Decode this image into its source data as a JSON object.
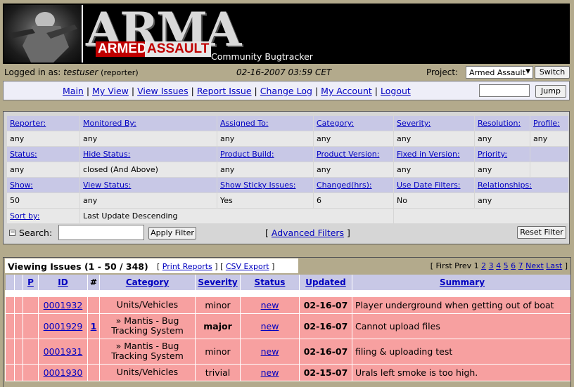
{
  "banner": {
    "logo_big": "ARMA",
    "logo_armed": "ARMED",
    "logo_assault": "ASSAULT",
    "subtitle": "Community Bugtracker"
  },
  "session": {
    "logged_in_label": "Logged in as:",
    "username": "testuser",
    "role": "(reporter)",
    "datetime": "02-16-2007 03:59 CET",
    "project_label": "Project:",
    "project_value": "Armed Assault",
    "switch_label": "Switch"
  },
  "menu": {
    "items": [
      "Main",
      "My View",
      "View Issues",
      "Report Issue",
      "Change Log",
      "My Account",
      "Logout"
    ],
    "jump_label": "Jump"
  },
  "filters": {
    "row1_headers": [
      "Reporter:",
      "Monitored By:",
      "Assigned To:",
      "Category:",
      "Severity:",
      "Resolution:",
      "Profile:"
    ],
    "row1_values": [
      "any",
      "any",
      "any",
      "any",
      "any",
      "any",
      "any"
    ],
    "row2_headers": [
      "Status:",
      "Hide Status:",
      "Product Build:",
      "Product Version:",
      "Fixed in Version:",
      "Priority:",
      ""
    ],
    "row2_values": [
      "any",
      "closed (And Above)",
      "any",
      "any",
      "any",
      "any",
      ""
    ],
    "row3_headers": [
      "Show:",
      "View Status:",
      "Show Sticky Issues:",
      "Changed(hrs):",
      "Use Date Filters:",
      "Relationships:",
      ""
    ],
    "row3_values": [
      "50",
      "any",
      "Yes",
      "6",
      "No",
      "any",
      ""
    ],
    "sort_label": "Sort by:",
    "sort_value": "Last Update Descending",
    "search_label": "Search:",
    "apply_label": "Apply Filter",
    "advanced_open": "[",
    "advanced_label": "Advanced Filters",
    "advanced_close": "]",
    "reset_label": "Reset Filter"
  },
  "issues": {
    "title": "Viewing Issues (1 - 50 / 348)",
    "print_label": "Print Reports",
    "csv_label": "CSV Export",
    "pager_prefix": "[ First Prev 1",
    "pages": [
      "2",
      "3",
      "4",
      "5",
      "6",
      "7"
    ],
    "next_label": "Next",
    "last_label": "Last",
    "pager_suffix": "]",
    "columns": [
      "P",
      "ID",
      "#",
      "Category",
      "Severity",
      "Status",
      "Updated",
      "Summary"
    ],
    "rows": [
      {
        "id": "0001932",
        "notes": "",
        "category": "Units/Vehicles",
        "severity": "minor",
        "status": "new",
        "updated": "02-16-07",
        "summary": "Player underground when getting out of boat"
      },
      {
        "id": "0001929",
        "notes": "1",
        "category": "» Mantis - Bug Tracking System",
        "severity": "major",
        "status": "new",
        "updated": "02-16-07",
        "summary": "Cannot upload files"
      },
      {
        "id": "0001931",
        "notes": "",
        "category": "» Mantis - Bug Tracking System",
        "severity": "minor",
        "status": "new",
        "updated": "02-16-07",
        "summary": "filing & uploading test"
      },
      {
        "id": "0001930",
        "notes": "",
        "category": "Units/Vehicles",
        "severity": "trivial",
        "status": "new",
        "updated": "02-15-07",
        "summary": "Urals left smoke is too high."
      }
    ]
  }
}
